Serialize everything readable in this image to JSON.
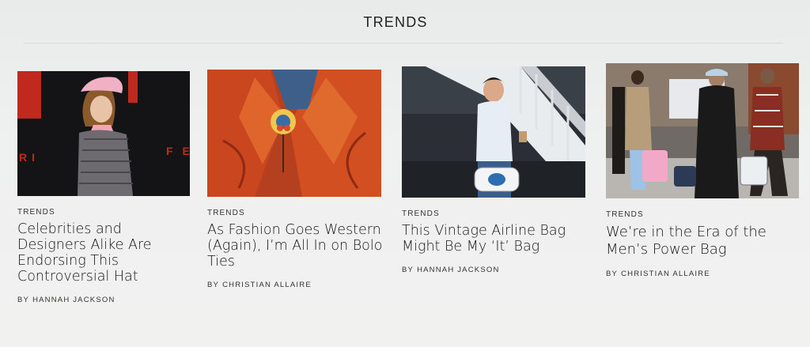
{
  "section": {
    "title": "TRENDS"
  },
  "cards": [
    {
      "label": "TRENDS",
      "headline": "Celebrities and Designers Alike Are Endorsing This Controversial Hat",
      "by": "BY",
      "author": "HANNAH JACKSON",
      "backdrop_text": "F E"
    },
    {
      "label": "TRENDS",
      "headline": "As Fashion Goes Western (Again), I’m All In on Bolo Ties",
      "by": "BY",
      "author": "CHRISTIAN ALLAIRE"
    },
    {
      "label": "TRENDS",
      "headline": "This Vintage Airline Bag Might Be My ‘It’ Bag",
      "by": "BY",
      "author": "HANNAH JACKSON"
    },
    {
      "label": "TRENDS",
      "headline": "We’re in the Era of the Men’s Power Bag",
      "by": "BY",
      "author": "CHRISTIAN ALLAIRE"
    }
  ]
}
